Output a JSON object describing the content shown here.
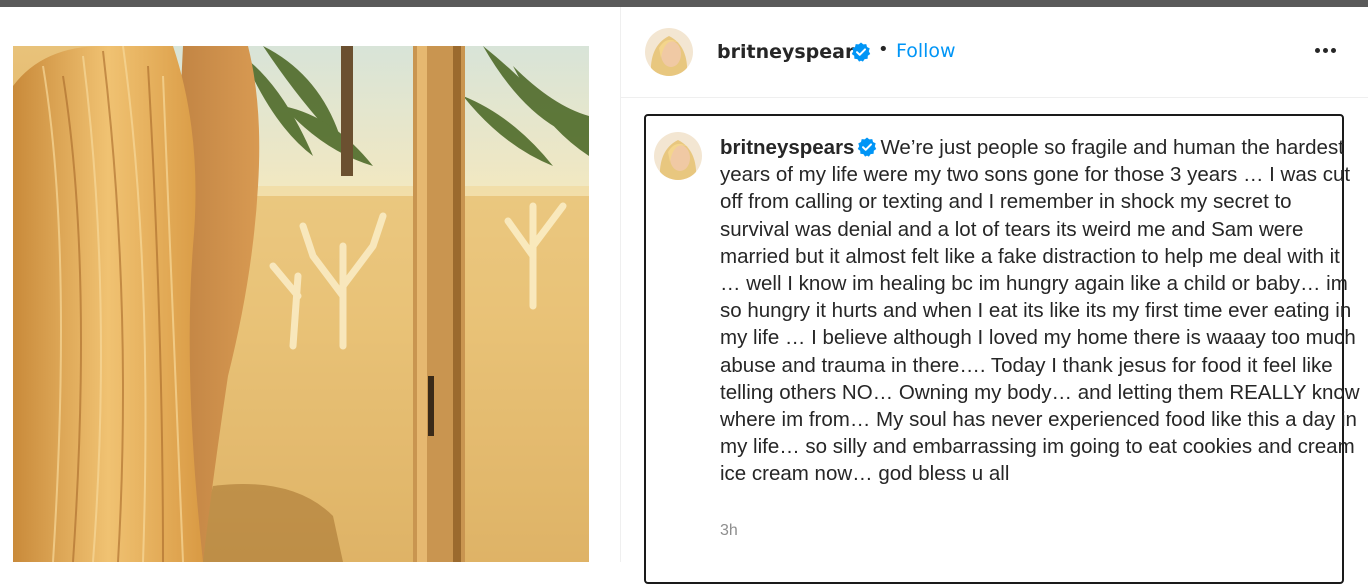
{
  "header": {
    "username": "britneyspears",
    "separator": "•",
    "follow_label": "Follow",
    "verified_icon": "verified-badge-icon",
    "more_icon": "more-options-icon"
  },
  "caption": {
    "username": "britneyspears",
    "text": "We’re just people so fragile and human the hardest years of my life were my two sons gone for those 3 years … I was cut off from calling or texting and I remember in shock my secret to survival was denial and a lot of tears its weird me and Sam were married but it almost felt like a fake distraction to help me deal with it … well I know im healing bc im hungry again like a child or baby… im so hungry it hurts and when I eat its like its my first time ever eating in my life … I believe although I loved my home there is waaay too much abuse and trauma in there…. Today I thank jesus for food it feel like telling others NO… Owning my body… and letting them REALLY know where im from… My soul has never experienced food like this a day in my life… so silly and embarrassing im going to eat cookies and cream ice cream now… god bless u all",
    "timestamp": "3h"
  },
  "colors": {
    "link_blue": "#0095f6",
    "verified_blue": "#0095f6",
    "text_dark": "#262626",
    "muted": "#8e8e8e"
  }
}
